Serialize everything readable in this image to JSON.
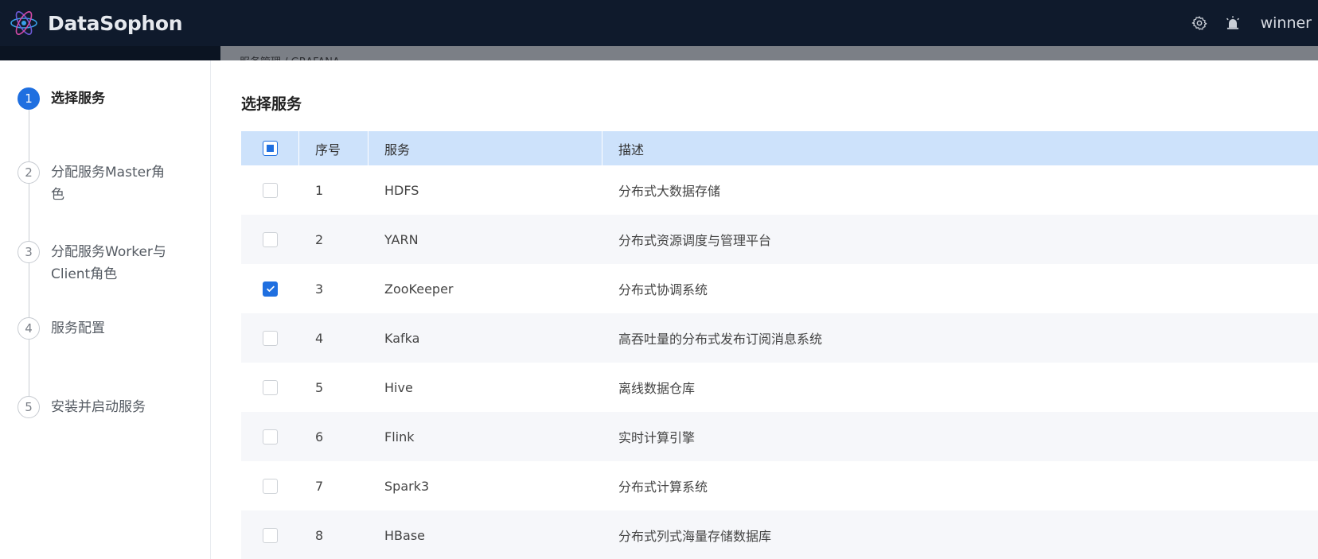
{
  "header": {
    "brand": "DataSophon",
    "user": "winner",
    "colors": {
      "bar": "#0f1a2c",
      "accent": "#1f6fe0"
    }
  },
  "background": {
    "breadcrumb": "服务管理  /  GRAFANA"
  },
  "steps": [
    {
      "num": "1",
      "label": "选择服务",
      "active": true
    },
    {
      "num": "2",
      "label": "分配服务Master角色"
    },
    {
      "num": "3",
      "label": "分配服务Worker与Client角色"
    },
    {
      "num": "4",
      "label": "服务配置"
    },
    {
      "num": "5",
      "label": "安装并启动服务"
    }
  ],
  "main": {
    "title": "选择服务",
    "columns": {
      "no": "序号",
      "service": "服务",
      "desc": "描述"
    },
    "rows": [
      {
        "no": "1",
        "service": "HDFS",
        "desc": "分布式大数据存储",
        "checked": false
      },
      {
        "no": "2",
        "service": "YARN",
        "desc": "分布式资源调度与管理平台",
        "checked": false
      },
      {
        "no": "3",
        "service": "ZooKeeper",
        "desc": "分布式协调系统",
        "checked": true
      },
      {
        "no": "4",
        "service": "Kafka",
        "desc": "高吞吐量的分布式发布订阅消息系统",
        "checked": false
      },
      {
        "no": "5",
        "service": "Hive",
        "desc": "离线数据仓库",
        "checked": false
      },
      {
        "no": "6",
        "service": "Flink",
        "desc": "实时计算引擎",
        "checked": false
      },
      {
        "no": "7",
        "service": "Spark3",
        "desc": "分布式计算系统",
        "checked": false
      },
      {
        "no": "8",
        "service": "HBase",
        "desc": "分布式列式海量存储数据库",
        "checked": false
      }
    ]
  }
}
